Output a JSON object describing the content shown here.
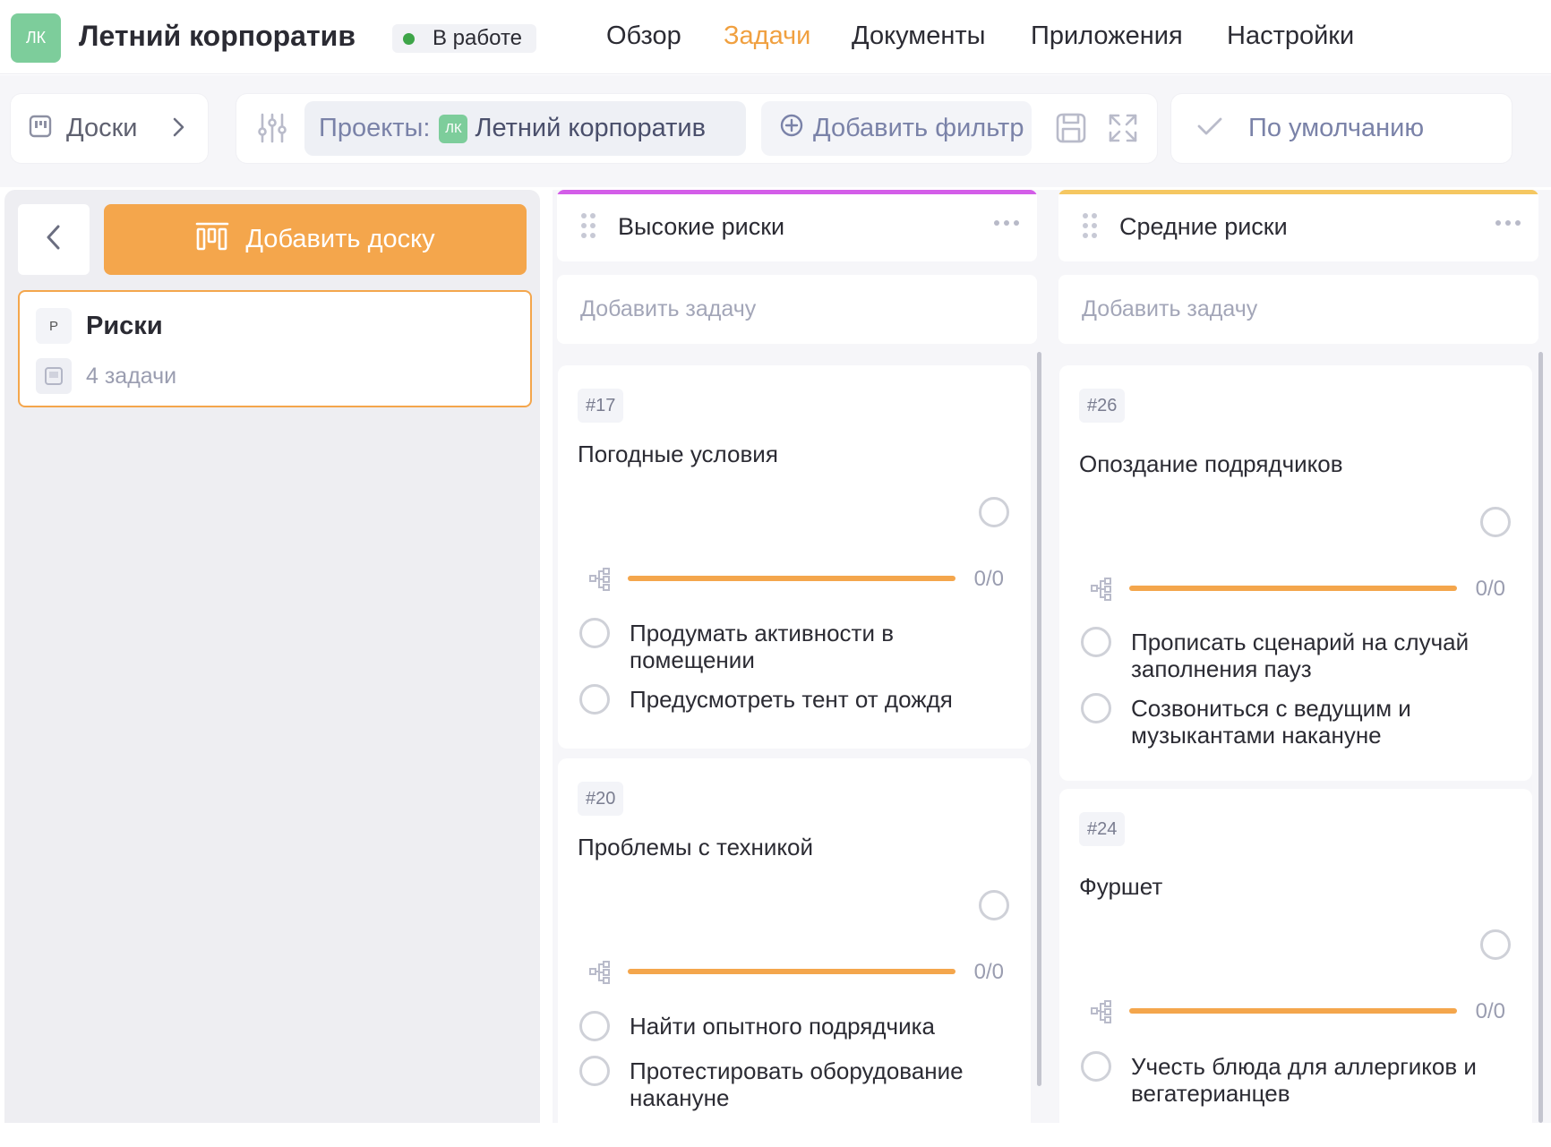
{
  "header": {
    "avatar": "ЛК",
    "title": "Летний корпоратив",
    "status": "В работе",
    "status_color": "#3ea548",
    "nav": [
      "Обзор",
      "Задачи",
      "Документы",
      "Приложения",
      "Настройки"
    ],
    "active_nav": "Задачи"
  },
  "toolbar": {
    "boards_label": "Доски",
    "projects_label": "Проекты:",
    "project_avatar": "ЛК",
    "project_value": "Летний корпоратив",
    "add_filter": "Добавить фильтр",
    "default_view": "По умолчанию"
  },
  "sidebar": {
    "add_board": "Добавить доску",
    "board": {
      "letter": "Р",
      "title": "Риски",
      "count": "4 задачи"
    }
  },
  "colors": {
    "accent": "#f4a64c",
    "high": "#d35de8",
    "medium": "#f5c761",
    "avatar": "#7dcd9b"
  },
  "columns": [
    {
      "title": "Высокие риски",
      "add_task": "Добавить задачу",
      "cards": [
        {
          "id": "#17",
          "title": "Погодные условия",
          "progress": "0/0",
          "progress_fraction": 1,
          "subtasks": [
            "Продумать активности в помещении",
            "Предусмотреть тент от дождя"
          ]
        },
        {
          "id": "#20",
          "title": "Проблемы с техникой",
          "progress": "0/0",
          "progress_fraction": 1,
          "subtasks": [
            "Найти опытного подрядчика",
            "Протестировать оборудование накануне"
          ]
        }
      ]
    },
    {
      "title": "Средние риски",
      "add_task": "Добавить задачу",
      "cards": [
        {
          "id": "#26",
          "title": "Опоздание подрядчиков",
          "progress": "0/0",
          "progress_fraction": 1,
          "subtasks": [
            "Прописать сценарий на случай заполнения пауз",
            "Созвониться с ведущим и музыкантами накануне"
          ]
        },
        {
          "id": "#24",
          "title": "Фуршет",
          "progress": "0/0",
          "progress_fraction": 1,
          "subtasks": [
            "Учесть блюда для аллергиков и вегатерианцев"
          ]
        }
      ]
    }
  ]
}
